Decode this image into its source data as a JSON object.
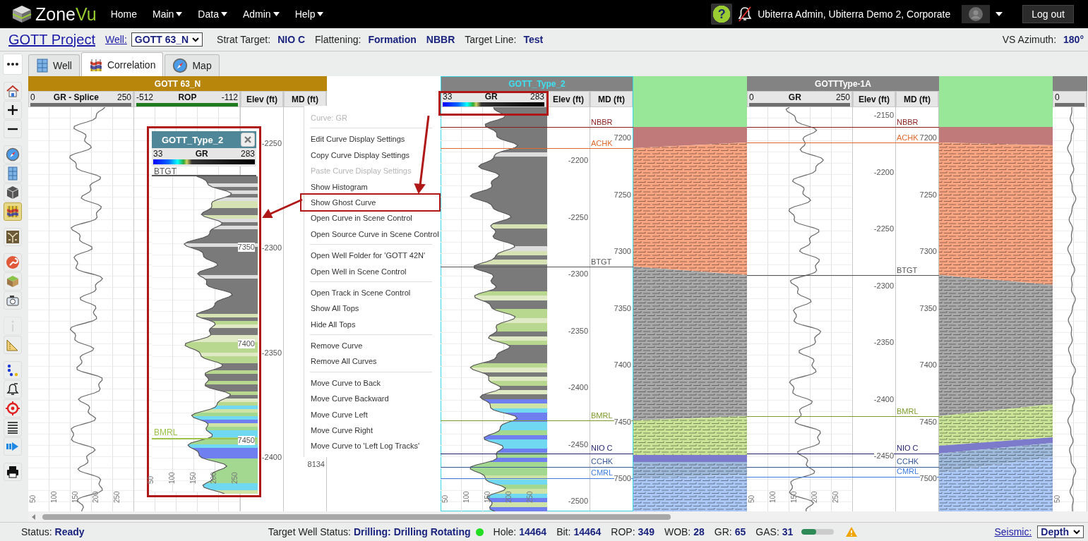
{
  "nav": {
    "logo": "ZoneVu",
    "menu": [
      {
        "label": "Home",
        "dropdown": false
      },
      {
        "label": "Main",
        "dropdown": true
      },
      {
        "label": "Data",
        "dropdown": true
      },
      {
        "label": "Admin",
        "dropdown": true
      },
      {
        "label": "Help",
        "dropdown": true
      }
    ],
    "help": "?",
    "user": "Ubiterra Admin, Ubiterra Demo 2, Corporate",
    "logout": "Log out"
  },
  "project": {
    "title": "GOTT Project",
    "well_label": "Well:",
    "well": "GOTT 63_N",
    "fields": [
      {
        "label": "Strat Target:",
        "values": [
          "NIO C"
        ]
      },
      {
        "label": "Flattening:",
        "values": [
          "Formation",
          "NBBR"
        ]
      },
      {
        "label": "Target Line:",
        "values": [
          "Test"
        ]
      }
    ],
    "azimuth_label": "VS Azimuth:",
    "azimuth": "180°"
  },
  "tabs": [
    {
      "label": "Well",
      "kind": "grid",
      "selected": false
    },
    {
      "label": "Correlation",
      "kind": "correlation",
      "selected": true
    },
    {
      "label": "Map",
      "kind": "compass",
      "selected": false
    }
  ],
  "toolbar": [
    [
      {
        "kind": "more",
        "selected": false,
        "disabled": false
      }
    ],
    [
      {
        "kind": "home",
        "selected": false,
        "disabled": false
      },
      {
        "kind": "zoom_in",
        "selected": false,
        "disabled": false
      },
      {
        "kind": "zoom_out",
        "selected": false,
        "disabled": false
      }
    ],
    [
      {
        "kind": "compass",
        "selected": false,
        "disabled": false
      },
      {
        "kind": "grid",
        "selected": false,
        "disabled": false
      },
      {
        "kind": "cube3d",
        "selected": false,
        "disabled": false
      },
      {
        "kind": "correlation",
        "selected": true,
        "disabled": false
      }
    ],
    [
      {
        "kind": "tree",
        "selected": false,
        "disabled": false
      }
    ],
    [
      {
        "kind": "wrench",
        "selected": false,
        "disabled": false
      },
      {
        "kind": "layers",
        "selected": false,
        "disabled": false
      },
      {
        "kind": "camera",
        "selected": false,
        "disabled": false
      }
    ],
    [
      {
        "kind": "info",
        "selected": false,
        "disabled": true
      },
      {
        "kind": "ruler",
        "selected": false,
        "disabled": false
      }
    ],
    [
      {
        "kind": "dots",
        "selected": false,
        "disabled": false
      },
      {
        "kind": "bell",
        "selected": false,
        "disabled": false
      },
      {
        "kind": "target",
        "selected": false,
        "disabled": false
      },
      {
        "kind": "lines",
        "selected": false,
        "disabled": false
      },
      {
        "kind": "arrow",
        "selected": false,
        "disabled": false
      }
    ],
    [
      {
        "kind": "print",
        "selected": false,
        "disabled": false
      }
    ]
  ],
  "columns": [
    {
      "kind": "well",
      "name": "GOTT 63_N",
      "selected": false,
      "tracks": [
        {
          "kind": "curve",
          "min": "0",
          "name": "GR - Splice",
          "max": "250",
          "color": "#6e6e6e",
          "axis": [
            "50",
            "100",
            "150",
            "200",
            "250"
          ]
        },
        {
          "kind": "scale",
          "min": "-512",
          "name": "ROP",
          "max": "-112",
          "color": "#1e7b1e"
        },
        {
          "kind": "elev",
          "name": "Elev (ft)",
          "labels": [
            "-2250",
            "-2300",
            "-2350",
            "-2400"
          ]
        },
        {
          "kind": "md",
          "name": "MD (ft)",
          "labels": [
            "8134"
          ]
        }
      ]
    },
    {
      "kind": "well",
      "name": "GOTT_Type_2",
      "selected": true,
      "tracks": [
        {
          "kind": "filled_curve",
          "min": "33",
          "name": "GR",
          "max": "283",
          "axis": [
            "50",
            "100",
            "150",
            "200",
            "250"
          ]
        },
        {
          "kind": "elev",
          "name": "Elev (ft)",
          "labels": [
            "-2200",
            "-2250",
            "-2300",
            "-2350",
            "-2400",
            "-2450",
            "-2500"
          ]
        },
        {
          "kind": "md",
          "name": "MD (ft)",
          "labels": [
            "7200",
            "7250",
            "7300",
            "7350",
            "7400",
            "7450",
            "7500"
          ]
        }
      ],
      "tops": [
        {
          "name": "NBBR",
          "color": "#8b1c1c"
        },
        {
          "name": "ACHK",
          "color": "#e06a2c"
        },
        {
          "name": "BTGT",
          "color": "#555555"
        },
        {
          "name": "BMRL",
          "color": "#7d9a2e"
        },
        {
          "name": "NIO C",
          "color": "#1f1f6b"
        },
        {
          "name": "CCHK",
          "color": "#3a5a9a"
        },
        {
          "name": "CMRL",
          "color": "#3f7de0"
        }
      ]
    },
    {
      "kind": "correlation"
    },
    {
      "kind": "well",
      "name": "GOTTType-1A",
      "selected": false,
      "tracks": [
        {
          "kind": "curve",
          "min": "0",
          "name": "GR",
          "max": "250",
          "color": "#6e6e6e",
          "axis": [
            "50",
            "100",
            "150",
            "200",
            "250"
          ]
        },
        {
          "kind": "elev",
          "name": "Elev (ft)",
          "labels": [
            "-2150",
            "-2200",
            "-2250",
            "-2300",
            "-2350",
            "-2400",
            "-2450"
          ]
        },
        {
          "kind": "md",
          "name": "MD (ft)",
          "labels": [
            "7200",
            "7250",
            "7300",
            "7350",
            "7400",
            "7450",
            "7500"
          ]
        }
      ],
      "tops": [
        {
          "name": "NBBR",
          "color": "#8b1c1c"
        },
        {
          "name": "ACHK",
          "color": "#e06a2c"
        },
        {
          "name": "BTGT",
          "color": "#555555"
        },
        {
          "name": "BMRL",
          "color": "#7d9a2e"
        },
        {
          "name": "NIO C",
          "color": "#1f1f6b"
        },
        {
          "name": "CCHK",
          "color": "#3a5a9a"
        },
        {
          "name": "CMRL",
          "color": "#3f7de0"
        }
      ]
    },
    {
      "kind": "correlation"
    },
    {
      "kind": "well",
      "selected": false,
      "tracks": [
        {
          "kind": "curve",
          "min": "0",
          "color": "#6e6e6e",
          "axis": [
            "50"
          ]
        }
      ]
    }
  ],
  "context_menu": [
    [
      {
        "label": "Curve: GR",
        "disabled": true,
        "highlighted": false
      }
    ],
    [
      {
        "label": "Edit Curve Display Settings",
        "disabled": false,
        "highlighted": false
      },
      {
        "label": "Copy Curve Display Settings",
        "disabled": false,
        "highlighted": false
      },
      {
        "label": "Paste Curve Display Settings",
        "disabled": true,
        "highlighted": false
      },
      {
        "label": "Show Histogram",
        "disabled": false,
        "highlighted": false
      },
      {
        "label": "Show Ghost Curve",
        "disabled": false,
        "highlighted": true
      },
      {
        "label": "Open Curve in Scene Control",
        "disabled": false,
        "highlighted": false
      },
      {
        "label": "Open Source Curve in Scene Control",
        "disabled": false,
        "highlighted": false
      }
    ],
    [
      {
        "label": "Open Well Folder for 'GOTT 42N'",
        "disabled": false,
        "highlighted": false
      },
      {
        "label": "Open Well in Scene Control",
        "disabled": false,
        "highlighted": false
      }
    ],
    [
      {
        "label": "Open Track in Scene Control",
        "disabled": false,
        "highlighted": false
      },
      {
        "label": "Show All Tops",
        "disabled": false,
        "highlighted": false
      },
      {
        "label": "Hide All Tops",
        "disabled": false,
        "highlighted": false
      }
    ],
    [
      {
        "label": "Remove Curve",
        "disabled": false,
        "highlighted": false
      },
      {
        "label": "Remove All Curves",
        "disabled": false,
        "highlighted": false
      }
    ],
    [
      {
        "label": "Move Curve to Back",
        "disabled": false,
        "highlighted": false
      },
      {
        "label": "Move Curve Backward",
        "disabled": false,
        "highlighted": false
      },
      {
        "label": "Move Curve Left",
        "disabled": false,
        "highlighted": false
      },
      {
        "label": "Move Curve Right",
        "disabled": false,
        "highlighted": false
      },
      {
        "label": "Move Curve to 'Left Log Tracks'",
        "disabled": false,
        "highlighted": false
      }
    ]
  ],
  "ghost": {
    "title": "GOTT_Type_2",
    "min": "33",
    "curve": "GR",
    "max": "283",
    "tops": [
      {
        "name": "BTGT",
        "color": "#555555"
      },
      {
        "name": "BMRL",
        "color": "#9cc34a"
      }
    ],
    "depths": [
      "7350",
      "7400",
      "7450"
    ],
    "axis": [
      "50",
      "100",
      "150",
      "200",
      "250"
    ]
  },
  "status": {
    "label": "Status:",
    "value": "Ready",
    "target": {
      "label": "Target Well Status:",
      "value": "Drilling: Drilling Rotating",
      "color": "#22dd22"
    },
    "metrics": [
      {
        "label": "Hole:",
        "value": "14464"
      },
      {
        "label": "Bit:",
        "value": "14464"
      },
      {
        "label": "ROP:",
        "value": "349"
      },
      {
        "label": "WOB:",
        "value": "28"
      },
      {
        "label": "GR:",
        "value": "65"
      },
      {
        "label": "GAS:",
        "value": "31"
      }
    ],
    "gas": {
      "level": 0.45
    },
    "seismic_label": "Seismic:",
    "seismic": "Depth"
  }
}
